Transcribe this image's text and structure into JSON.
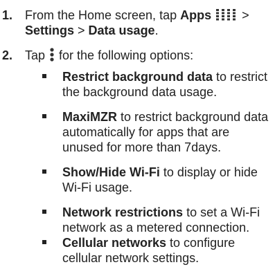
{
  "steps": [
    {
      "number": "1.",
      "line1_prefix": "From the Home screen, tap ",
      "apps_label": "Apps",
      "apps_icon": "apps-grid-icon",
      "line1_suffix": " >",
      "settings_label": "Settings",
      "separator": " > ",
      "data_usage_label": "Data usage",
      "period": "."
    },
    {
      "number": "2.",
      "prefix": "Tap ",
      "menu_icon": "overflow-menu-icon",
      "suffix": " for the following options:"
    }
  ],
  "options": [
    {
      "title": "Restrict background data",
      "desc_line1": " to restrict",
      "desc_lines": [
        "the background data usage."
      ]
    },
    {
      "title": "MaxiMZR",
      "desc_line1": " to restrict background data",
      "desc_lines": [
        "automatically for apps that are",
        "unused for more than 7days."
      ]
    },
    {
      "title": "Show/Hide Wi-Fi",
      "desc_line1": " to display or hide",
      "desc_lines": [
        "Wi-Fi usage."
      ]
    },
    {
      "title": "Network restrictions",
      "desc_line1": " to set a Wi-Fi",
      "desc_lines": [
        "network as a metered connection."
      ]
    },
    {
      "title": "Cellular networks",
      "desc_line1": " to configure",
      "desc_lines": [
        "cellular network settings."
      ]
    }
  ]
}
